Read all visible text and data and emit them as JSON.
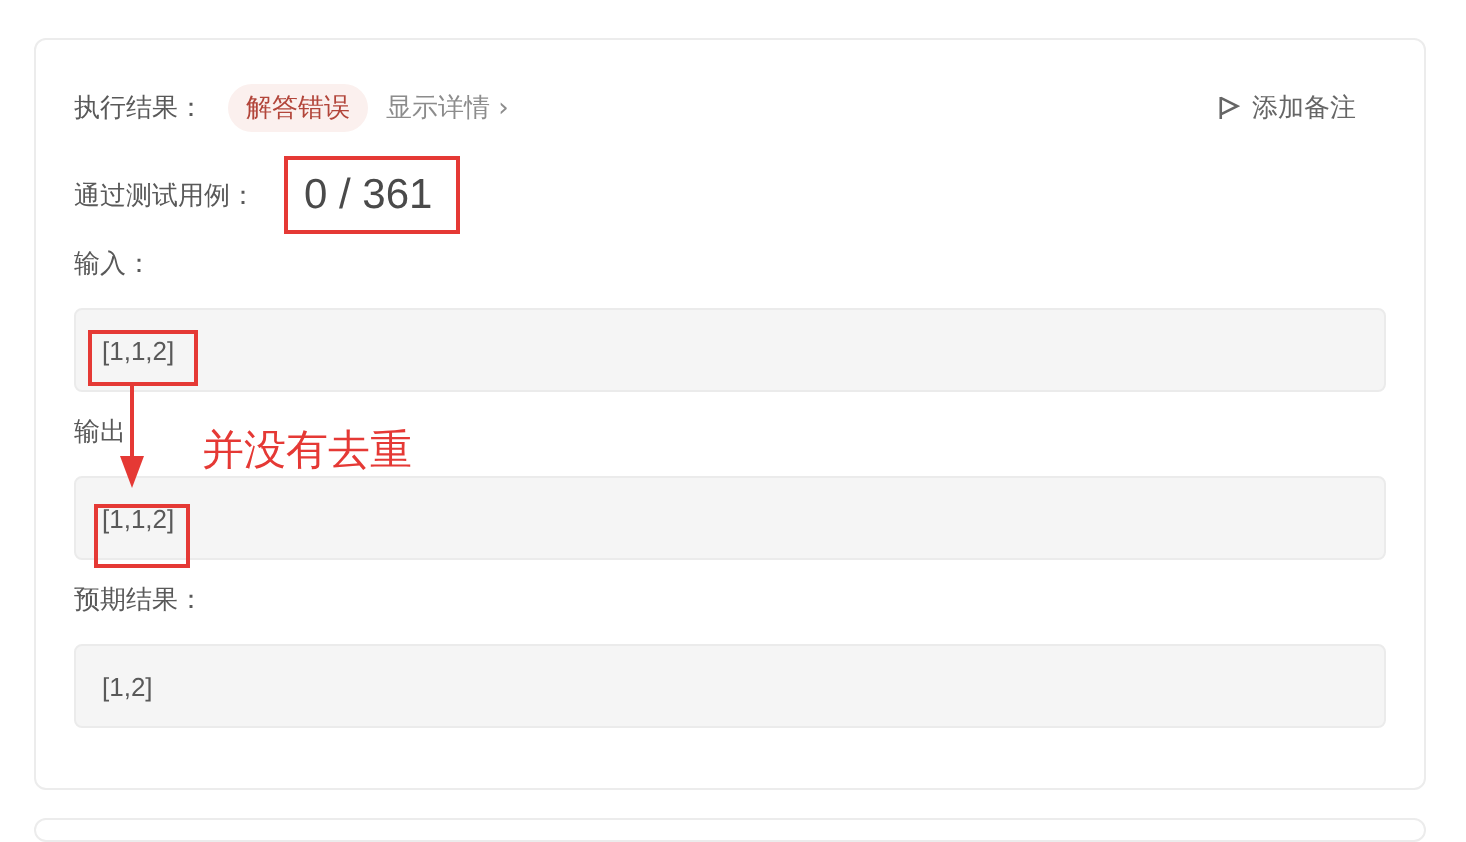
{
  "result": {
    "label": "执行结果：",
    "status": "解答错误",
    "details_link": "显示详情 ›",
    "note_button": "添加备注"
  },
  "passed": {
    "label": "通过测试用例：",
    "count": "0 / 361"
  },
  "fields": [
    {
      "label": "输入：",
      "value": "[1,1,2]"
    },
    {
      "label": "输出",
      "value": "[1,1,2]"
    },
    {
      "label": "预期结果：",
      "value": "[1,2]"
    }
  ],
  "annotation": {
    "text": "并没有去重"
  }
}
